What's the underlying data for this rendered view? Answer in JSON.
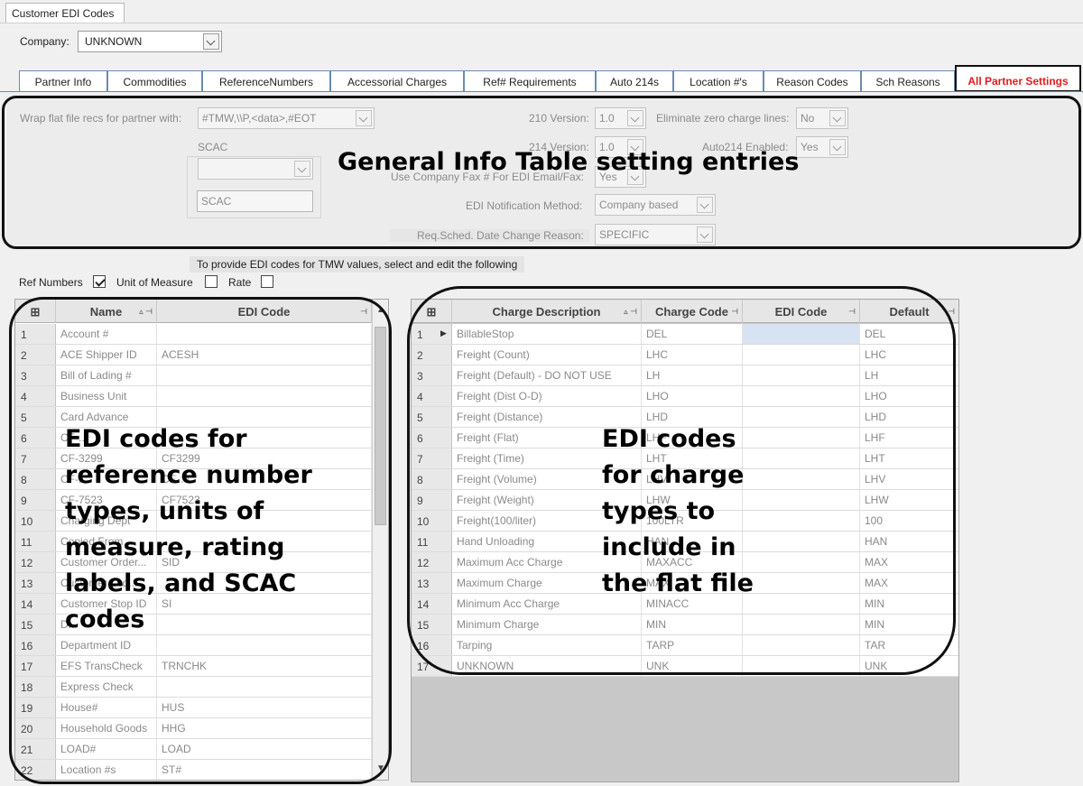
{
  "window_tab": "Customer EDI Codes",
  "company": {
    "label": "Company:",
    "value": "UNKNOWN"
  },
  "tabs": [
    "Partner Info",
    "Commodities",
    "ReferenceNumbers",
    "Accessorial Charges",
    "Ref# Requirements",
    "Auto 214s",
    "Location #'s",
    "Reason Codes",
    "Sch Reasons",
    "All Partner Settings"
  ],
  "settings": {
    "wrap_label": "Wrap flat file recs for partner with:",
    "wrap_value": "#TMW,\\\\P,<data>,#EOT",
    "scac_group": "SCAC",
    "scac_combo": "",
    "scac_text": "SCAC",
    "v210_label": "210 Version:",
    "v210_value": "1.0",
    "v214_label": "214 Version:",
    "v214_value": "1.0",
    "fax_label": "Use Company Fax # For EDI Email/Fax:",
    "fax_value": "Yes",
    "notif_label": "EDI Notification Method:",
    "notif_value": "Company based",
    "reason_label": "Req.Sched. Date Change Reason:",
    "reason_value": "SPECIFIC",
    "zero_label": "Eliminate zero charge lines:",
    "zero_value": "No",
    "auto214_label": "Auto214 Enabled:",
    "auto214_value": "Yes"
  },
  "annotation_general": "General Info Table setting entries",
  "provide_text": "To provide EDI codes for TMW values, select and edit the following",
  "checkboxes": {
    "ref": "Ref Numbers",
    "uom": "Unit of Measure",
    "rate": "Rate"
  },
  "left_grid": {
    "headers": [
      "Name",
      "EDI Code"
    ],
    "rows": [
      [
        "1",
        "Account #",
        ""
      ],
      [
        "2",
        "ACE Shipper ID",
        "ACESH"
      ],
      [
        "3",
        "Bill of Lading #",
        ""
      ],
      [
        "4",
        "Business Unit",
        ""
      ],
      [
        "5",
        "Card Advance",
        ""
      ],
      [
        "6",
        "CF-...",
        ""
      ],
      [
        "7",
        "CF-3299",
        "CF3299"
      ],
      [
        "8",
        "CF-...",
        "CF...4"
      ],
      [
        "9",
        "CF-7523",
        "CF7523"
      ],
      [
        "10",
        "Charging Dept",
        ""
      ],
      [
        "11",
        "Copied From",
        ""
      ],
      [
        "12",
        "Customer Order...",
        "SID"
      ],
      [
        "13",
        "Customer Ord...",
        ""
      ],
      [
        "14",
        "Customer Stop ID",
        "SI"
      ],
      [
        "15",
        "D...",
        ""
      ],
      [
        "16",
        "Department ID",
        ""
      ],
      [
        "17",
        "EFS TransCheck",
        "TRNCHK"
      ],
      [
        "18",
        "Express Check",
        ""
      ],
      [
        "19",
        "House#",
        "HUS"
      ],
      [
        "20",
        "Household Goods",
        "HHG"
      ],
      [
        "21",
        "LOAD#",
        "LOAD"
      ],
      [
        "22",
        "Location #s",
        "ST#"
      ]
    ]
  },
  "annotation_left": "EDI codes for reference number types, units of measure, rating labels, and SCAC codes",
  "right_grid": {
    "headers": [
      "Charge Description",
      "Charge Code",
      "EDI Code",
      "Default"
    ],
    "rows": [
      [
        "1",
        "BillableStop",
        "DEL",
        "",
        "DEL"
      ],
      [
        "2",
        "Freight (Count)",
        "LHC",
        "",
        "LHC"
      ],
      [
        "3",
        "Freight (Default) - DO NOT USE",
        "LH",
        "",
        "LH"
      ],
      [
        "4",
        "Freight (Dist O-D)",
        "LHO",
        "",
        "LHO"
      ],
      [
        "5",
        "Freight (Distance)",
        "LHD",
        "",
        "LHD"
      ],
      [
        "6",
        "Freight (Flat)",
        "LHF",
        "",
        "LHF"
      ],
      [
        "7",
        "Freight (Time)",
        "LHT",
        "",
        "LHT"
      ],
      [
        "8",
        "Freight (Volume)",
        "LHV",
        "",
        "LHV"
      ],
      [
        "9",
        "Freight (Weight)",
        "LHW",
        "",
        "LHW"
      ],
      [
        "10",
        "Freight(100/liter)",
        "100LTR",
        "",
        "100"
      ],
      [
        "11",
        "Hand Unloading",
        "HAN",
        "",
        "HAN"
      ],
      [
        "12",
        "Maximum Acc Charge",
        "MAXACC",
        "",
        "MAX"
      ],
      [
        "13",
        "Maximum Charge",
        "MAX",
        "",
        "MAX"
      ],
      [
        "14",
        "Minimum Acc Charge",
        "MINACC",
        "",
        "MIN"
      ],
      [
        "15",
        "Minimum Charge",
        "MIN",
        "",
        "MIN"
      ],
      [
        "16",
        "Tarping",
        "TARP",
        "",
        "TAR"
      ],
      [
        "17",
        "UNKNOWN",
        "UNK",
        "",
        "UNK"
      ]
    ]
  },
  "annotation_right": "EDI codes for charge types to include in the flat file",
  "colors": {
    "active_tab_text": "#e31b1b",
    "tab_border": "#6b8bb0",
    "outline": "#111111"
  }
}
